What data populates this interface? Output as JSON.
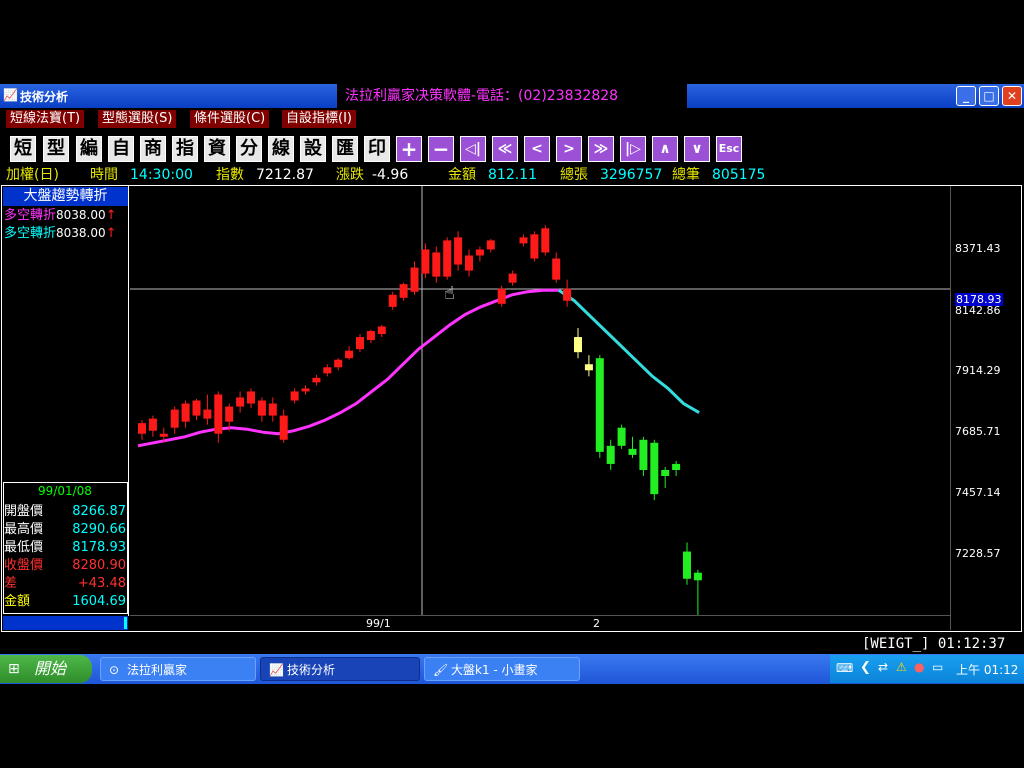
{
  "window": {
    "app_title": "技術分析",
    "center_title": "法拉利贏家决策軟體-電話：(02)23832828",
    "btn_min": "_",
    "btn_max": "□",
    "btn_close": "✕"
  },
  "menu": [
    "短線法寶(T)",
    "型態選股(S)",
    "條件選股(C)",
    "自設指標(I)"
  ],
  "toolbar": [
    "短",
    "型",
    "編",
    "自",
    "商",
    "指",
    "資",
    "分",
    "線",
    "設",
    "匯",
    "印"
  ],
  "toolbar_icons": [
    "+",
    "−",
    "◁|",
    "≪",
    "<",
    ">",
    "≫",
    "|▷",
    "∧",
    "∨",
    "Esc"
  ],
  "info": {
    "mode": "加權(日)",
    "time_label": "時間",
    "time_value": "14:30:00",
    "index_label": "指數",
    "index_value": "7212.87",
    "change_label": "漲跌",
    "change_value": "-4.96",
    "amount_label": "金額",
    "amount_value": "812.11",
    "vol_label": "總張",
    "vol_value": "3296757",
    "count_label": "總筆",
    "count_value": "805175"
  },
  "panel": {
    "title": "大盤趨勢轉折",
    "signals": [
      {
        "label": "多空轉折",
        "value": "8038.00",
        "arrow": "↑",
        "color": "#ff33ff"
      },
      {
        "label": "多空轉折",
        "value": "8038.00",
        "arrow": "↑",
        "color": "#00ffff"
      }
    ],
    "date": "99/01/08",
    "ohlc": [
      {
        "k": "開盤價",
        "v": "8266.87",
        "kc": "#ffffff",
        "vc": "#00ffff"
      },
      {
        "k": "最高價",
        "v": "8290.66",
        "kc": "#ffffff",
        "vc": "#00ffff"
      },
      {
        "k": "最低價",
        "v": "8178.93",
        "kc": "#ffffff",
        "vc": "#00ffff"
      },
      {
        "k": "收盤價",
        "v": "8280.90",
        "kc": "#ff3030",
        "vc": "#ff3030"
      },
      {
        "k": "差",
        "v": "+43.48",
        "kc": "#ff3030",
        "vc": "#ff3030"
      },
      {
        "k": "金額",
        "v": "1604.69",
        "kc": "#ffff00",
        "vc": "#00ffff"
      }
    ]
  },
  "yaxis": [
    "8371.43",
    "8142.86",
    "7914.29",
    "7685.71",
    "7457.14",
    "7228.57"
  ],
  "cursor_price": "8178.93",
  "xaxis": [
    "99/1",
    "2"
  ],
  "status_right": "[WEIGT_]  01:12:37",
  "taskbar": {
    "start": "開始",
    "tasks": [
      "法拉利贏家",
      "技術分析",
      "大盤k1 - 小畫家"
    ],
    "clock": "上午 01:12"
  },
  "colors": {
    "up": "#ff1a1a",
    "down": "#22ee22",
    "yellow": "#ffff88",
    "ma_magenta": "#ff33ff",
    "ma_cyan": "#33dddd"
  },
  "chart_data": {
    "type": "candlestick",
    "ylim": [
      7100,
      8520
    ],
    "candles": [
      {
        "o": 7700,
        "h": 7745,
        "l": 7680,
        "c": 7735,
        "s": "up"
      },
      {
        "o": 7710,
        "h": 7760,
        "l": 7690,
        "c": 7750,
        "s": "up"
      },
      {
        "o": 7690,
        "h": 7720,
        "l": 7670,
        "c": 7700,
        "s": "up"
      },
      {
        "o": 7720,
        "h": 7790,
        "l": 7700,
        "c": 7780,
        "s": "up"
      },
      {
        "o": 7740,
        "h": 7810,
        "l": 7720,
        "c": 7800,
        "s": "up"
      },
      {
        "o": 7760,
        "h": 7815,
        "l": 7745,
        "c": 7810,
        "s": "up"
      },
      {
        "o": 7750,
        "h": 7830,
        "l": 7730,
        "c": 7780,
        "s": "up"
      },
      {
        "o": 7700,
        "h": 7840,
        "l": 7670,
        "c": 7830,
        "s": "up"
      },
      {
        "o": 7740,
        "h": 7800,
        "l": 7710,
        "c": 7790,
        "s": "up"
      },
      {
        "o": 7790,
        "h": 7840,
        "l": 7770,
        "c": 7820,
        "s": "up"
      },
      {
        "o": 7800,
        "h": 7850,
        "l": 7785,
        "c": 7840,
        "s": "up"
      },
      {
        "o": 7760,
        "h": 7820,
        "l": 7740,
        "c": 7810,
        "s": "up"
      },
      {
        "o": 7760,
        "h": 7820,
        "l": 7740,
        "c": 7800,
        "s": "up"
      },
      {
        "o": 7680,
        "h": 7780,
        "l": 7670,
        "c": 7760,
        "s": "up"
      },
      {
        "o": 7810,
        "h": 7850,
        "l": 7800,
        "c": 7840,
        "s": "up"
      },
      {
        "o": 7840,
        "h": 7860,
        "l": 7830,
        "c": 7850,
        "s": "up"
      },
      {
        "o": 7870,
        "h": 7895,
        "l": 7860,
        "c": 7885,
        "s": "up"
      },
      {
        "o": 7900,
        "h": 7930,
        "l": 7890,
        "c": 7920,
        "s": "up"
      },
      {
        "o": 7920,
        "h": 7950,
        "l": 7910,
        "c": 7945,
        "s": "up"
      },
      {
        "o": 7950,
        "h": 7990,
        "l": 7945,
        "c": 7975,
        "s": "up"
      },
      {
        "o": 7980,
        "h": 8030,
        "l": 7970,
        "c": 8020,
        "s": "up"
      },
      {
        "o": 8010,
        "h": 8045,
        "l": 8000,
        "c": 8040,
        "s": "up"
      },
      {
        "o": 8030,
        "h": 8060,
        "l": 8020,
        "c": 8055,
        "s": "up"
      },
      {
        "o": 8120,
        "h": 8170,
        "l": 8110,
        "c": 8160,
        "s": "up"
      },
      {
        "o": 8150,
        "h": 8200,
        "l": 8140,
        "c": 8195,
        "s": "up"
      },
      {
        "o": 8170,
        "h": 8270,
        "l": 8160,
        "c": 8250,
        "s": "up"
      },
      {
        "o": 8230,
        "h": 8330,
        "l": 8215,
        "c": 8310,
        "s": "up"
      },
      {
        "o": 8220,
        "h": 8320,
        "l": 8200,
        "c": 8300,
        "s": "up"
      },
      {
        "o": 8220,
        "h": 8350,
        "l": 8210,
        "c": 8340,
        "s": "up"
      },
      {
        "o": 8260,
        "h": 8370,
        "l": 8240,
        "c": 8350,
        "s": "up"
      },
      {
        "o": 8240,
        "h": 8310,
        "l": 8220,
        "c": 8290,
        "s": "up"
      },
      {
        "o": 8290,
        "h": 8320,
        "l": 8270,
        "c": 8310,
        "s": "up"
      },
      {
        "o": 8310,
        "h": 8345,
        "l": 8300,
        "c": 8340,
        "s": "up"
      },
      {
        "o": 8130,
        "h": 8190,
        "l": 8120,
        "c": 8180,
        "s": "up"
      },
      {
        "o": 8200,
        "h": 8240,
        "l": 8190,
        "c": 8230,
        "s": "up"
      },
      {
        "o": 8330,
        "h": 8360,
        "l": 8320,
        "c": 8350,
        "s": "up"
      },
      {
        "o": 8280,
        "h": 8370,
        "l": 8270,
        "c": 8360,
        "s": "up"
      },
      {
        "o": 8300,
        "h": 8390,
        "l": 8290,
        "c": 8380,
        "s": "up"
      },
      {
        "o": 8210,
        "h": 8300,
        "l": 8200,
        "c": 8280,
        "s": "up"
      },
      {
        "o": 8140,
        "h": 8210,
        "l": 8120,
        "c": 8180,
        "s": "up"
      },
      {
        "o": 8020,
        "h": 8050,
        "l": 7950,
        "c": 7970,
        "s": "yellow"
      },
      {
        "o": 7930,
        "h": 7960,
        "l": 7890,
        "c": 7910,
        "s": "yellow"
      },
      {
        "o": 7950,
        "h": 7960,
        "l": 7620,
        "c": 7640,
        "s": "down"
      },
      {
        "o": 7660,
        "h": 7680,
        "l": 7580,
        "c": 7600,
        "s": "down"
      },
      {
        "o": 7720,
        "h": 7730,
        "l": 7650,
        "c": 7660,
        "s": "down"
      },
      {
        "o": 7650,
        "h": 7690,
        "l": 7620,
        "c": 7630,
        "s": "down"
      },
      {
        "o": 7680,
        "h": 7690,
        "l": 7560,
        "c": 7580,
        "s": "down"
      },
      {
        "o": 7670,
        "h": 7680,
        "l": 7480,
        "c": 7500,
        "s": "down"
      },
      {
        "o": 7580,
        "h": 7590,
        "l": 7520,
        "c": 7560,
        "s": "down"
      },
      {
        "o": 7600,
        "h": 7610,
        "l": 7560,
        "c": 7580,
        "s": "down"
      },
      {
        "o": 7310,
        "h": 7340,
        "l": 7200,
        "c": 7220,
        "s": "down"
      },
      {
        "o": 7240,
        "h": 7250,
        "l": 7100,
        "c": 7215,
        "s": "down"
      }
    ],
    "ma_magenta": [
      7660,
      7670,
      7680,
      7690,
      7705,
      7715,
      7720,
      7715,
      7705,
      7700,
      7710,
      7725,
      7745,
      7770,
      7800,
      7840,
      7880,
      7930,
      7980,
      8020,
      8060,
      8095,
      8120,
      8140,
      8160,
      8170,
      8175,
      8175
    ],
    "ma_cyan": [
      8175,
      8140,
      8090,
      8040,
      7990,
      7940,
      7890,
      7850,
      7800,
      7770
    ]
  }
}
